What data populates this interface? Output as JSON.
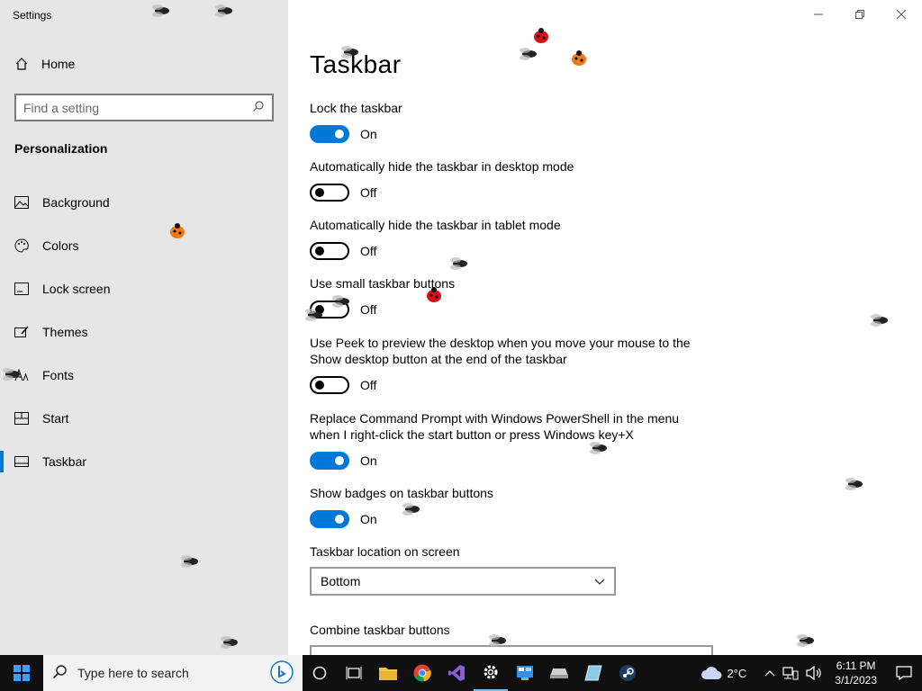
{
  "app": {
    "title": "Settings"
  },
  "sidebar": {
    "home_label": "Home",
    "search_placeholder": "Find a setting",
    "section_title": "Personalization",
    "items": [
      {
        "label": "Background",
        "icon": "picture-icon",
        "active": false
      },
      {
        "label": "Colors",
        "icon": "palette-icon",
        "active": false
      },
      {
        "label": "Lock screen",
        "icon": "lock-screen-icon",
        "active": false
      },
      {
        "label": "Themes",
        "icon": "themes-icon",
        "active": false
      },
      {
        "label": "Fonts",
        "icon": "fonts-icon",
        "active": false
      },
      {
        "label": "Start",
        "icon": "start-icon",
        "active": false
      },
      {
        "label": "Taskbar",
        "icon": "taskbar-icon",
        "active": true
      }
    ]
  },
  "main": {
    "page_title": "Taskbar",
    "settings": [
      {
        "label": "Lock the taskbar",
        "state": "On"
      },
      {
        "label": "Automatically hide the taskbar in desktop mode",
        "state": "Off"
      },
      {
        "label": "Automatically hide the taskbar in tablet mode",
        "state": "Off"
      },
      {
        "label": "Use small taskbar buttons",
        "state": "Off"
      },
      {
        "label": "Use Peek to preview the desktop when you move your mouse to the Show desktop button at the end of the taskbar",
        "state": "Off"
      },
      {
        "label": "Replace Command Prompt with Windows PowerShell in the menu when I right-click the start button or press Windows key+X",
        "state": "On"
      },
      {
        "label": "Show badges on taskbar buttons",
        "state": "On"
      }
    ],
    "location_label": "Taskbar location on screen",
    "location_value": "Bottom",
    "combine_label": "Combine taskbar buttons"
  },
  "taskbar": {
    "search_placeholder": "Type here to search",
    "weather": "2°C",
    "time": "6:11 PM",
    "date": "3/1/2023"
  },
  "colors": {
    "accent": "#0078d7",
    "sidebar_bg": "#e6e6e6",
    "taskbar_bg": "#101010"
  }
}
